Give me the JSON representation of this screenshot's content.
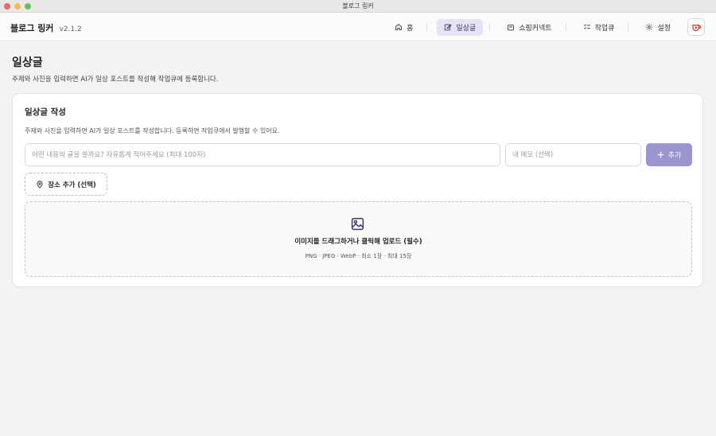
{
  "window": {
    "title": "블로그 링커"
  },
  "brand": {
    "name": "블로그 링커",
    "version": "v2.1.2"
  },
  "nav": [
    {
      "label": "홈",
      "icon": "home-icon",
      "active": false
    },
    {
      "label": "일상글",
      "icon": "edit-icon",
      "active": true
    },
    {
      "label": "쇼핑커넥트",
      "icon": "shopping-bag-icon",
      "active": false
    },
    {
      "label": "작업큐",
      "icon": "checklist-icon",
      "active": false
    },
    {
      "label": "설정",
      "icon": "gear-icon",
      "active": false
    }
  ],
  "page": {
    "title": "일상글",
    "description": "주제와 사진을 입력하면 AI가 일상 포스트를 작성해 작업큐에 등록합니다."
  },
  "card": {
    "title": "일상글 작성",
    "description": "주제와 사진을 입력하면 AI가 일상 포스트를 작성합니다. 등록하면 작업큐에서 발행할 수 있어요.",
    "topic_placeholder": "어떤 내용의 글을 쓸까요? 자유롭게 적어주세요 (최대 100자)",
    "memo_placeholder": "내 메모 (선택)",
    "add_label": "추가",
    "place_label": "장소 추가 (선택)",
    "upload_title": "이미지를 드래그하거나 클릭해 업로드 (필수)",
    "upload_hint": "PNG · JPEG · WebP · 최소 1장 · 최대 15장"
  },
  "colors": {
    "accent": "#9a94cf",
    "active_nav_bg": "#e6e3f5",
    "background": "#f3f3f1",
    "profile_icon": "#c0392b"
  }
}
